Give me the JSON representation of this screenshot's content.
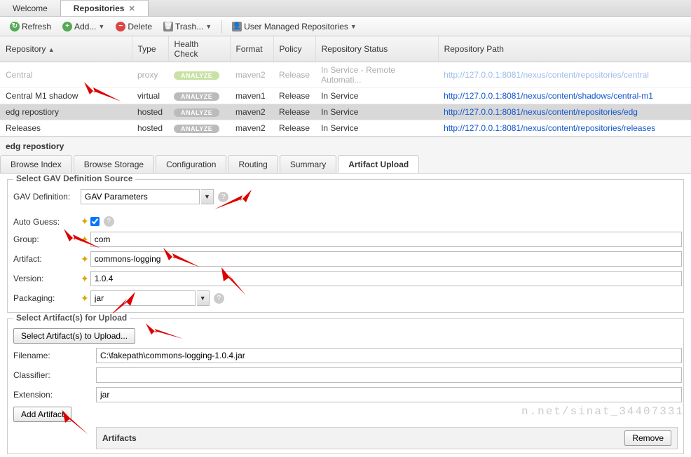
{
  "topTabs": {
    "welcome": "Welcome",
    "repos": "Repositories"
  },
  "toolbar": {
    "refresh": "Refresh",
    "add": "Add...",
    "delete": "Delete",
    "trash": "Trash...",
    "umr": "User Managed Repositories"
  },
  "gridHeaders": {
    "repo": "Repository",
    "type": "Type",
    "health": "Health Check",
    "format": "Format",
    "policy": "Policy",
    "status": "Repository Status",
    "path": "Repository Path"
  },
  "rows": [
    {
      "repo": "Central",
      "type": "proxy",
      "analyze": "ANALYZE",
      "green": true,
      "format": "maven2",
      "policy": "Release",
      "status": "In Service - Remote Automati...",
      "path": "http://127.0.0.1:8081/nexus/content/repositories/central"
    },
    {
      "repo": "Central M1 shadow",
      "type": "virtual",
      "analyze": "ANALYZE",
      "green": false,
      "format": "maven1",
      "policy": "Release",
      "status": "In Service",
      "path": "http://127.0.0.1:8081/nexus/content/shadows/central-m1"
    },
    {
      "repo": "edg repostiory",
      "type": "hosted",
      "analyze": "ANALYZE",
      "green": false,
      "format": "maven2",
      "policy": "Release",
      "status": "In Service",
      "path": "http://127.0.0.1:8081/nexus/content/repositories/edg",
      "sel": true
    },
    {
      "repo": "Releases",
      "type": "hosted",
      "analyze": "ANALYZE",
      "green": false,
      "format": "maven2",
      "policy": "Release",
      "status": "In Service",
      "path": "http://127.0.0.1:8081/nexus/content/repositories/releases"
    }
  ],
  "detailTitle": "edg repostiory",
  "detailTabs": {
    "browseIndex": "Browse Index",
    "browseStorage": "Browse Storage",
    "configuration": "Configuration",
    "routing": "Routing",
    "summary": "Summary",
    "artifactUpload": "Artifact Upload"
  },
  "gavSection": {
    "legend": "Select GAV Definition Source",
    "gavDefLabel": "GAV Definition:",
    "gavDefValue": "GAV Parameters",
    "autoGuessLabel": "Auto Guess:",
    "groupLabel": "Group:",
    "groupValue": "com",
    "artifactLabel": "Artifact:",
    "artifactValue": "commons-logging",
    "versionLabel": "Version:",
    "versionValue": "1.0.4",
    "packagingLabel": "Packaging:",
    "packagingValue": "jar"
  },
  "uploadSection": {
    "legend": "Select Artifact(s) for Upload",
    "selectBtn": "Select Artifact(s) to Upload...",
    "filenameLabel": "Filename:",
    "filenameValue": "C:\\fakepath\\commons-logging-1.0.4.jar",
    "classifierLabel": "Classifier:",
    "classifierValue": "",
    "extensionLabel": "Extension:",
    "extensionValue": "jar",
    "addBtn": "Add Artifact",
    "artifactsTitle": "Artifacts",
    "removeBtn": "Remove"
  },
  "watermark": "n.net/sinat_34407331"
}
